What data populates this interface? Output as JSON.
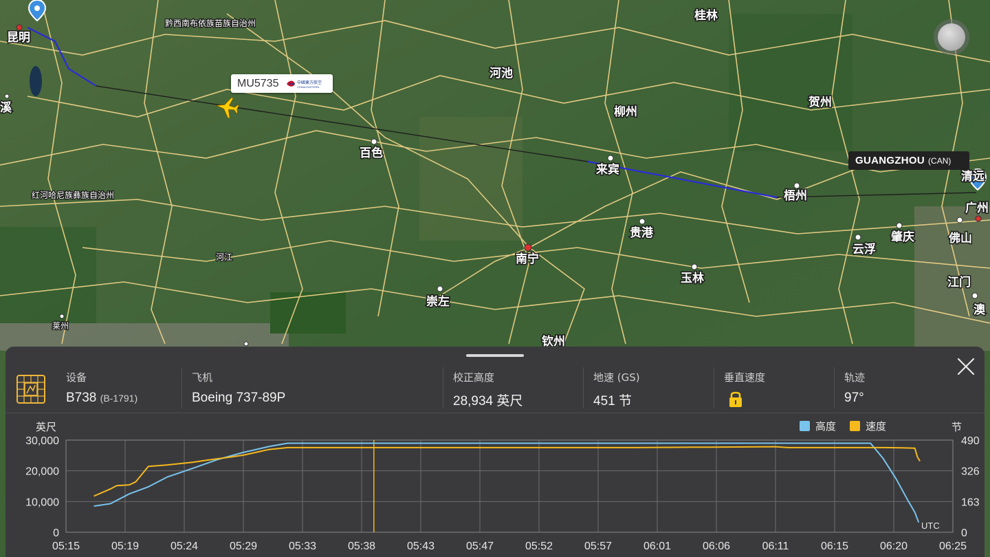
{
  "map": {
    "cities": [
      {
        "id": "kunming",
        "name": "昆明"
      },
      {
        "id": "guilin",
        "name": "桂林"
      },
      {
        "id": "hechi",
        "name": "河池"
      },
      {
        "id": "liuzhou",
        "name": "柳州"
      },
      {
        "id": "hezhou",
        "name": "贺州"
      },
      {
        "id": "baise",
        "name": "百色"
      },
      {
        "id": "laibin",
        "name": "来宾"
      },
      {
        "id": "wuzhou",
        "name": "梧州"
      },
      {
        "id": "qingyuan",
        "name": "清远"
      },
      {
        "id": "guangzhou",
        "name": "广州"
      },
      {
        "id": "guigang",
        "name": "贵港"
      },
      {
        "id": "zhaoqing",
        "name": "肇庆"
      },
      {
        "id": "foshan",
        "name": "佛山"
      },
      {
        "id": "nanning",
        "name": "南宁"
      },
      {
        "id": "yunfu",
        "name": "云浮"
      },
      {
        "id": "yulin",
        "name": "玉林"
      },
      {
        "id": "jiangmen",
        "name": "江门"
      },
      {
        "id": "chongzuo",
        "name": "崇左"
      },
      {
        "id": "qinzhou",
        "name": "钦州"
      },
      {
        "id": "macau",
        "name": "澳"
      },
      {
        "id": "yuxi",
        "name": "溪"
      }
    ],
    "regions": [
      {
        "id": "qianxinan",
        "name": "黔西南布依族苗族自治州"
      },
      {
        "id": "honghe",
        "name": "红河哈尼族彝族自治州"
      },
      {
        "id": "hejiang",
        "name": "河江"
      },
      {
        "id": "laizhou",
        "name": "莱州"
      }
    ],
    "flight_label": "MU5735",
    "airline_logo_text": "中國東方航空",
    "airline_logo_sub": "CHINA EASTERN",
    "destination": {
      "name": "GUANGZHOU",
      "code": "(CAN)"
    },
    "colors": {
      "track": "#2b2bd9",
      "planned": "#1e1e1e",
      "aircraft": "#ffcc00",
      "pin": "#3d8fe0",
      "roads": "#f2d58a"
    }
  },
  "panel": {
    "icon": "chip-icon",
    "equipment": {
      "label": "设备",
      "value": "B738",
      "reg": "(B-1791)"
    },
    "aircraft": {
      "label": "飞机",
      "value": "Boeing 737-89P"
    },
    "altitude": {
      "label": "校正高度",
      "value": "28,934 英尺"
    },
    "ground_speed": {
      "label": "地速 (GS)",
      "value": "451 节"
    },
    "vertical_speed": {
      "label": "垂直速度",
      "icon": "lock-icon"
    },
    "track": {
      "label": "轨迹",
      "value": "97°"
    }
  },
  "chart_data": {
    "type": "line",
    "ylabel": "英尺",
    "y2label": "节",
    "utc_label": "UTC",
    "ylim": [
      0,
      30000
    ],
    "y2lim": [
      0,
      490
    ],
    "yticks": [
      "30,000",
      "20,000",
      "10,000",
      "0"
    ],
    "y2ticks": [
      "490",
      "326",
      "163",
      "0"
    ],
    "xticks": [
      "05:15",
      "05:19",
      "05:24",
      "05:29",
      "05:33",
      "05:38",
      "05:43",
      "05:47",
      "05:52",
      "05:57",
      "06:01",
      "06:06",
      "06:11",
      "06:15",
      "06:20",
      "06:25"
    ],
    "xlim_minutes": [
      315,
      385
    ],
    "series": [
      {
        "name": "高度",
        "color": "#79c3ec",
        "points": [
          [
            317.2,
            8500
          ],
          [
            318.5,
            9300
          ],
          [
            320,
            12500
          ],
          [
            321.5,
            14800
          ],
          [
            323,
            18000
          ],
          [
            325,
            20800
          ],
          [
            327,
            23700
          ],
          [
            329,
            26000
          ],
          [
            331,
            27900
          ],
          [
            332.5,
            29000
          ],
          [
            340,
            29000
          ],
          [
            360,
            29000
          ],
          [
            375,
            29000
          ],
          [
            378.5,
            29000
          ],
          [
            379.5,
            24000
          ],
          [
            380.5,
            17500
          ],
          [
            381.5,
            10000
          ],
          [
            382,
            6500
          ],
          [
            382.3,
            3200
          ]
        ]
      },
      {
        "name": "速度",
        "color": "#f5b91e",
        "points": [
          [
            317.2,
            192
          ],
          [
            318.5,
            230
          ],
          [
            319,
            248
          ],
          [
            320,
            252
          ],
          [
            320.5,
            268
          ],
          [
            321.5,
            350
          ],
          [
            323,
            358
          ],
          [
            325,
            372
          ],
          [
            326,
            382
          ],
          [
            328,
            400
          ],
          [
            329,
            410
          ],
          [
            331,
            440
          ],
          [
            332.5,
            450
          ],
          [
            345,
            450
          ],
          [
            360,
            450
          ],
          [
            371,
            455
          ],
          [
            372,
            450
          ],
          [
            379.5,
            450
          ],
          [
            381,
            449
          ],
          [
            382,
            447
          ],
          [
            382.2,
            400
          ],
          [
            382.4,
            378
          ]
        ]
      }
    ],
    "gap_marker_minute": 339.3
  }
}
